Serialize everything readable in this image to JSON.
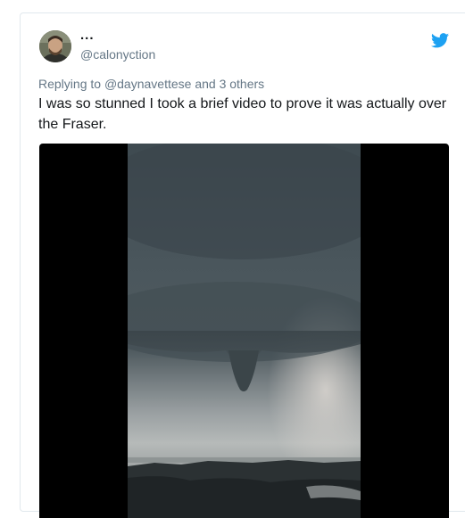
{
  "tweet": {
    "display_name": "...",
    "handle": "@calonyction",
    "reply_prefix": "Replying to",
    "reply_mention": "@daynavettese",
    "reply_suffix": "and 3 others",
    "text": "I was so stunned I took a brief video to prove it was actually over the Fraser."
  },
  "icons": {
    "brand": "twitter-bird-icon",
    "brand_color": "#1da1f2"
  },
  "colors": {
    "text_primary": "#14171a",
    "text_secondary": "#657786",
    "border": "#e1e8ed"
  }
}
